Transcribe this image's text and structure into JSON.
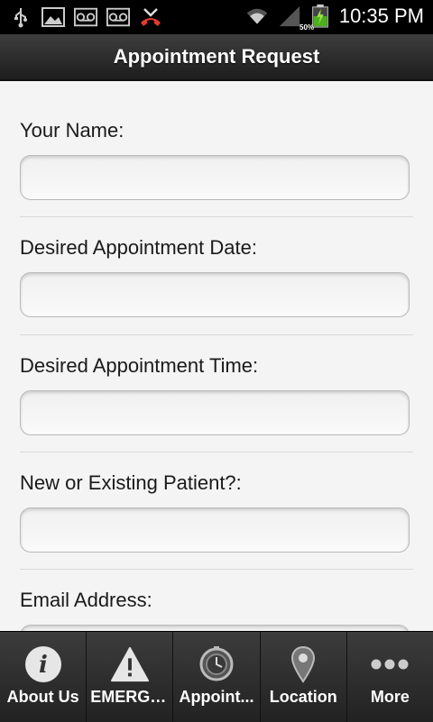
{
  "status_bar": {
    "time": "10:35 PM",
    "battery_percent": "50%",
    "icons": [
      "usb-icon",
      "image-icon",
      "voicemail-icon",
      "voicemail-icon",
      "missed-call-icon",
      "wifi-icon",
      "signal-icon",
      "battery-icon"
    ]
  },
  "header": {
    "title": "Appointment Request"
  },
  "form": {
    "fields": [
      {
        "label": "Your Name:",
        "value": ""
      },
      {
        "label": "Desired Appointment Date:",
        "value": ""
      },
      {
        "label": "Desired Appointment Time:",
        "value": ""
      },
      {
        "label": "New or Existing Patient?:",
        "value": ""
      },
      {
        "label": "Email Address:",
        "value": ""
      }
    ]
  },
  "tabs": [
    {
      "label": "About Us",
      "icon": "info-icon"
    },
    {
      "label": "EMERGE...",
      "icon": "warning-icon"
    },
    {
      "label": "Appoint...",
      "icon": "clock-icon"
    },
    {
      "label": "Location",
      "icon": "map-pin-icon"
    },
    {
      "label": "More",
      "icon": "more-icon"
    }
  ]
}
